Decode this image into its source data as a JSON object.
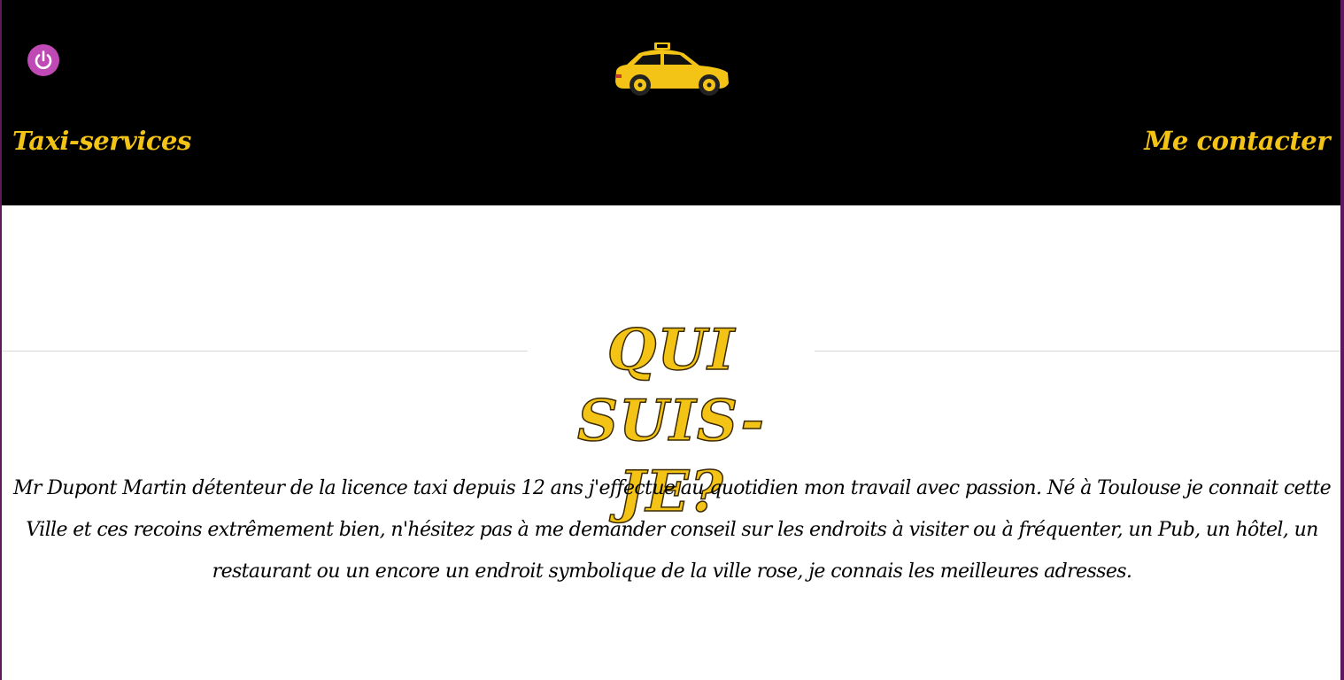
{
  "header": {
    "power_icon": "power-icon",
    "logo_icon": "taxi-car-icon",
    "nav_left": "Taxi-services",
    "nav_right": "Me contacter"
  },
  "main": {
    "title": "QUI SUIS-JE?",
    "bio": "Mr Dupont Martin détenteur de la licence taxi depuis 12 ans j'effectue au quotidien mon travail avec passion. Né à Toulouse je connait cette Ville et ces recoins extrêmement bien, n'hésitez pas à me demander conseil sur les endroits à visiter ou à fréquenter, un Pub, un hôtel, un restaurant ou un encore un endroit symbolique de la ville rose, je connais les meilleures adresses."
  },
  "colors": {
    "header_bg": "#000000",
    "accent_yellow": "#f3c316",
    "power_button": "#c04ab5",
    "page_bg": "#ffffff",
    "outer_frame": "#5a1a5c"
  }
}
